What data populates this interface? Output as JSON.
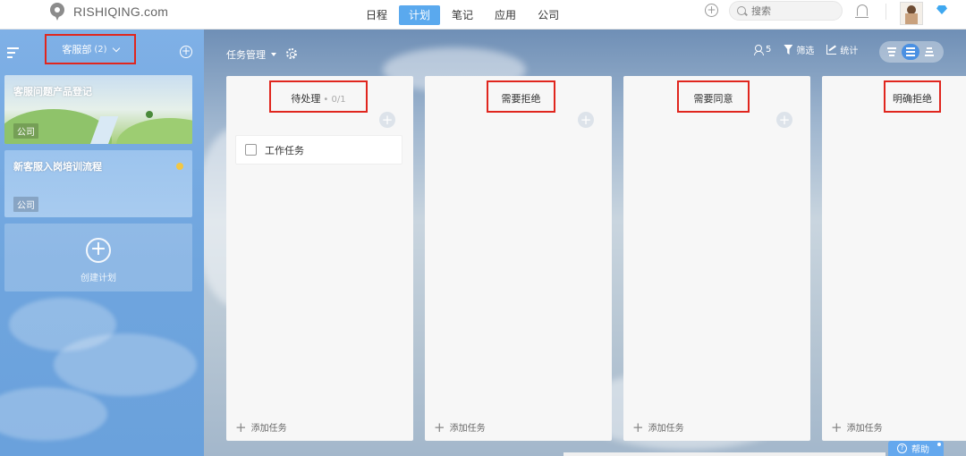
{
  "app": {
    "logo_text": "RISHIQING.com"
  },
  "nav": {
    "items": [
      {
        "label": "日程",
        "active": false
      },
      {
        "label": "计划",
        "active": true
      },
      {
        "label": "笔记",
        "active": false
      },
      {
        "label": "应用",
        "active": false
      },
      {
        "label": "公司",
        "active": false
      }
    ]
  },
  "header": {
    "search_placeholder": "搜索"
  },
  "sidebar": {
    "department": "客服部",
    "department_count": "(2)",
    "plans": [
      {
        "title": "客服问题产品登记",
        "tag": "公司"
      },
      {
        "title": "新客服入岗培训流程",
        "tag": "公司"
      }
    ],
    "new_plan_label": "创建计划"
  },
  "board": {
    "title": "任务管理",
    "toolbar": {
      "members_count": "5",
      "filter_label": "筛选",
      "stats_label": "统计"
    },
    "columns": [
      {
        "title": "待处理",
        "count": "• 0/1",
        "tasks": [
          {
            "title": "工作任务"
          }
        ],
        "add_task_label": "添加任务"
      },
      {
        "title": "需要拒绝",
        "count": "",
        "tasks": [],
        "add_task_label": "添加任务"
      },
      {
        "title": "需要同意",
        "count": "",
        "tasks": [],
        "add_task_label": "添加任务"
      },
      {
        "title": "明确拒绝",
        "count": "",
        "tasks": [],
        "add_task_label": "添加任务"
      }
    ]
  },
  "help": {
    "label": "帮助"
  },
  "colors": {
    "accent": "#5aa9ee",
    "highlight_box": "#e0261e"
  }
}
